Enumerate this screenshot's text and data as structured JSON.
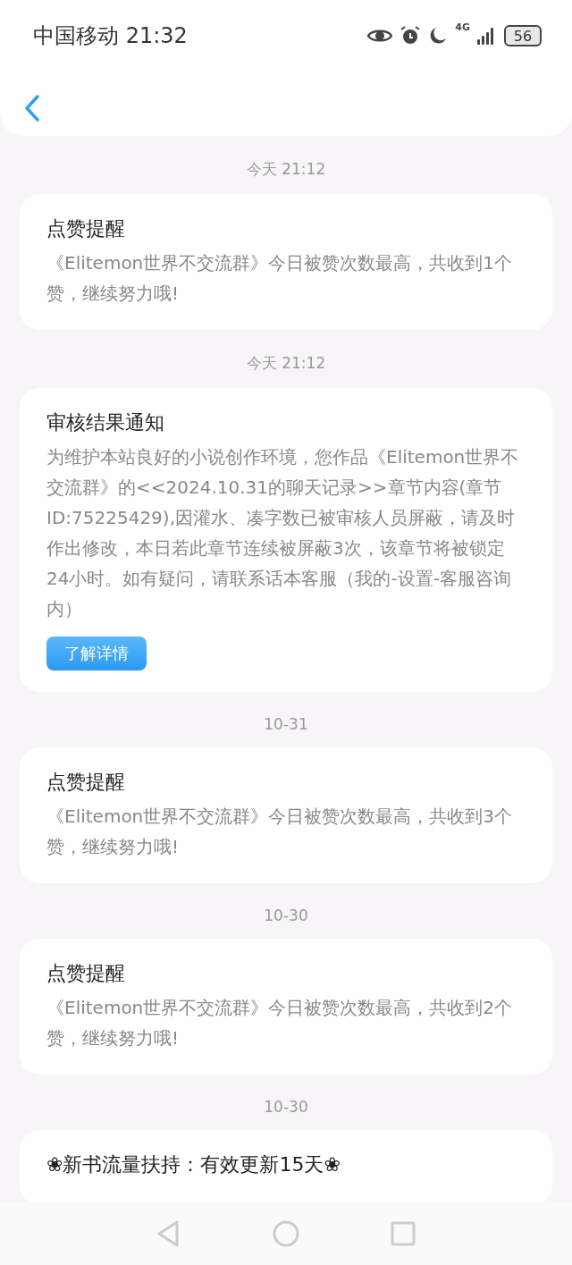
{
  "status_bar": {
    "carrier": "中国移动",
    "time": "21:32",
    "network": "4G",
    "battery": "56"
  },
  "messages": [
    {
      "time": "今天 21:12",
      "title": "点赞提醒",
      "body": "《Elitemon世界不交流群》今日被赞次数最高，共收到1个赞，继续努力哦!"
    },
    {
      "time": "今天 21:12",
      "title": "审核结果通知",
      "body": "为维护本站良好的小说创作环境，您作品《Elitemon世界不交流群》的<<2024.10.31的聊天记录>>章节内容(章节ID:75225429),因灌水、凑字数已被审核人员屏蔽，请及时作出修改，本日若此章节连续被屏蔽3次，该章节将被锁定24小时。如有疑问，请联系话本客服（我的-设置-客服咨询内）",
      "button": "了解详情"
    },
    {
      "time": "10-31",
      "title": "点赞提醒",
      "body": "《Elitemon世界不交流群》今日被赞次数最高，共收到3个赞，继续努力哦!"
    },
    {
      "time": "10-30",
      "title": "点赞提醒",
      "body": "《Elitemon世界不交流群》今日被赞次数最高，共收到2个赞，继续努力哦!"
    },
    {
      "time": "10-30",
      "title": "❀新书流量扶持：有效更新15天❀"
    }
  ]
}
